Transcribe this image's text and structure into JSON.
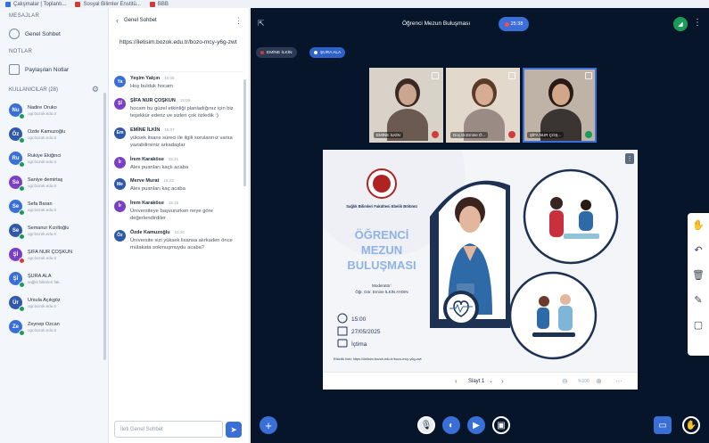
{
  "browser_tabs": [
    {
      "label": "Çalışmalar | Toplantı..."
    },
    {
      "label": "Sosyal Bilimler Enstitü..."
    },
    {
      "label": "BBB"
    }
  ],
  "sidebar": {
    "section_messages": "MESAJLAR",
    "public_chat": "Genel Sohbet",
    "section_notes": "NOTLAR",
    "shared_notes": "Paylaşılan Notlar",
    "users_header": "KULLANICILAR (28)",
    "users": [
      {
        "initials": "Nu",
        "name": "Nadire Oruko",
        "sub": "ogr.bozok.edu.tr",
        "color": "#3a6fd8",
        "mic": "on"
      },
      {
        "initials": "Öz",
        "name": "Özde Kamuzoğlu",
        "sub": "ogr.bozok.edu.tr",
        "color": "#2f58a8",
        "mic": "on"
      },
      {
        "initials": "Ru",
        "name": "Rukiye Ekiğinci",
        "sub": "ogr.bozok.edu.tr",
        "color": "#3a6fd8",
        "mic": "on"
      },
      {
        "initials": "Sa",
        "name": "Saniye demirtaş",
        "sub": "ogr.bozok.edu.tr",
        "color": "#7b3fc4",
        "mic": "on"
      },
      {
        "initials": "Se",
        "name": "Sefa Baran",
        "sub": "ogr.bozok.edu.tr",
        "color": "#3a6fd8",
        "mic": "on"
      },
      {
        "initials": "Se",
        "name": "Semanur Kızıltoğlu",
        "sub": "ogr.bozok.edu.tr",
        "color": "#2f58a8",
        "mic": "on"
      },
      {
        "initials": "Şİ",
        "name": "ŞİFA NUR ÇOŞKUN",
        "sub": "ogr.bozok.edu.tr",
        "color": "#7b3fc4",
        "mic": "off"
      },
      {
        "initials": "Şİ",
        "name": "ŞURA ALA",
        "sub": "sağlık bilimleri fak.",
        "color": "#3a6fd8",
        "mic": "on"
      },
      {
        "initials": "Ür",
        "name": "Ürsula Açıkgöz",
        "sub": "ogr.bozok.edu.tr",
        "color": "#2f58a8",
        "mic": "on"
      },
      {
        "initials": "Ze",
        "name": "Zeynep Özcan",
        "sub": "ogr.bozok.edu.tr",
        "color": "#3a6fd8",
        "mic": "on"
      }
    ]
  },
  "chat": {
    "title": "Genel Sohbet",
    "pinned": "https://iletisim.bozok.edu.tr/bozo-mcy-y6g-zwt",
    "messages": [
      {
        "initials": "Ya",
        "name": "Yeşim Yalçın",
        "time": "15:06",
        "text": "Hoş bulduk hocam",
        "color": "#3a6fd8"
      },
      {
        "initials": "Şİ",
        "name": "ŞİFA NUR ÇOŞKUN",
        "time": "15:06",
        "text": "hocam bu güzel etkinliği planladığınız için biz teşekkür ederiz ve sizleri çok özledik :)",
        "color": "#7b3fc4"
      },
      {
        "initials": "Em",
        "name": "EMİNE İLKİN",
        "time": "15:07",
        "text": "yüksek lisans süreci ile ilgili sorularınız varsa yazabilirsiniz arkadaşlar",
        "color": "#2f58a8"
      },
      {
        "initials": "İr",
        "name": "İrem Karaköse",
        "time": "15:21",
        "text": "Ales puanları kaçtı acaba",
        "color": "#7b3fc4"
      },
      {
        "initials": "Me",
        "name": "Merve Murat",
        "time": "15:23",
        "text": "Ales puanları kaç acaba",
        "color": "#2f58a8"
      },
      {
        "initials": "İr",
        "name": "İrem Karaköse",
        "time": "15:25",
        "text": "Üniversiteye başvururken neye göre değerlendirdiler",
        "color": "#7b3fc4"
      },
      {
        "initials": "Öz",
        "name": "Özde Kamuzoğlu",
        "time": "15:26",
        "text": "Üniversite sizi yüksek lisansa alırkaden önce mülakata sokmuşmuydu acaba?",
        "color": "#2f58a8"
      }
    ],
    "input_placeholder": "İleti Genel Sohbet"
  },
  "meeting": {
    "title": "Öğrenci Mezun Buluşması",
    "timer": "25:38",
    "talkers": [
      "EMİNE İLKİN",
      "ŞURA ALA"
    ],
    "videos": [
      {
        "name": "EMİNE İLKİN",
        "mic": "off",
        "bg": "#d8d2c8",
        "skin": "#caa58f",
        "hair": "#3b2a22",
        "shirt": "#6b5a52"
      },
      {
        "name": "Doç.Dr.Emine Ö...",
        "mic": "off",
        "bg": "#e2d9cc",
        "skin": "#d6ad92",
        "hair": "#5a3a28",
        "shirt": "#9a8c85"
      },
      {
        "name": "ŞİFA NUR ÇOŞ...",
        "mic": "on",
        "bg": "#bfb2a6",
        "skin": "#d2a688",
        "hair": "#2a1a14",
        "shirt": "#3a3432"
      }
    ]
  },
  "slide": {
    "logo_text": "Sağlık Bilimleri Fakültesi Ebelik Bölümü",
    "title_lines": [
      "ÖĞRENCİ",
      "MEZUN",
      "BULUŞMASI"
    ],
    "moderator_label": "Moderatör:",
    "moderator_name": "Öğr. Gör. Emine İLKİN AYDIN",
    "time": "15:00",
    "date": "27/05/2025",
    "place": "İçtima",
    "link_text": "Etkinlik linki: https://iletisim.bozok.edu.tr/bozo-mcy-y6g-zwt",
    "nav_name": "Slayt 1",
    "zoom": "%100"
  },
  "colors": {
    "accent": "#3a6fd8",
    "dark_bg": "#07152b",
    "slide_title": "#8fb3e6",
    "slide_dark": "#1d3153"
  }
}
